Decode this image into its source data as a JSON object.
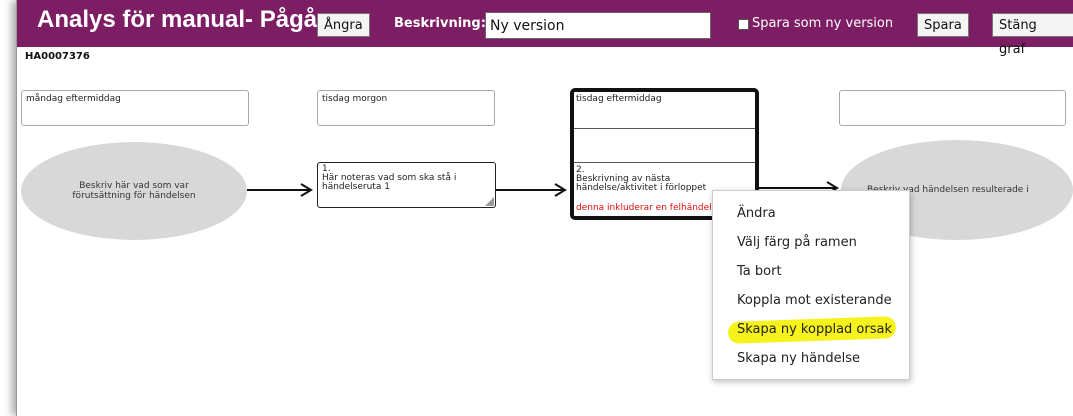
{
  "header": {
    "title": "Analys för manual- Pågår",
    "undo_label": "Ångra",
    "description_label": "Beskrivning:",
    "description_value": "Ny version",
    "save_as_new_label": "Spara som ny version",
    "save_label": "Spara",
    "close_graph_label": "Stäng graf",
    "colors": {
      "bar": "#7d1d63"
    }
  },
  "case_id": "HA0007376",
  "timeline": [
    "måndag eftermiddag",
    "tisdag morgon",
    "tisdag eftermiddag",
    ""
  ],
  "start_ellipse": {
    "line1": "Beskriv här vad som var",
    "line2": "förutsättning för händelsen"
  },
  "event1": {
    "number": "1.",
    "line1": "Här noteras vad som ska stå i",
    "line2": "händelseruta 1"
  },
  "event2": {
    "number": "2.",
    "line1": "Beskrivning av nästa",
    "line2": "händelse/aktivitet i förloppet",
    "note": "denna inkluderar en felhändelse"
  },
  "end_ellipse": {
    "text": "Beskriv vad händelsen resulterade i"
  },
  "context_menu": {
    "items": [
      "Ändra",
      "Välj färg på ramen",
      "Ta bort",
      "Koppla mot existerande",
      "Skapa ny kopplad orsak",
      "Skapa ny händelse"
    ],
    "highlighted_index": 4
  }
}
